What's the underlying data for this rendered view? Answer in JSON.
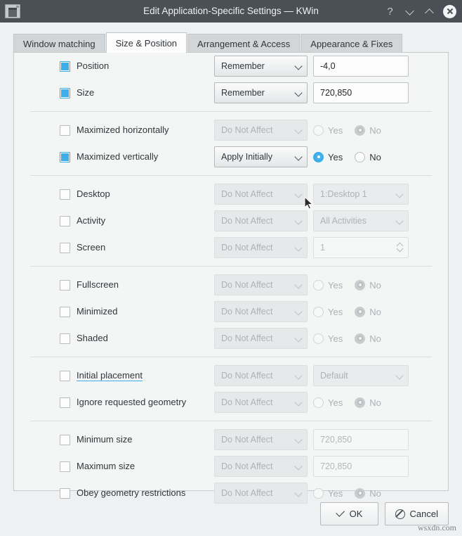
{
  "window": {
    "title": "Edit Application-Specific Settings — KWin",
    "icon": "window-settings-icon",
    "help_label": "?",
    "minimize_label": "minimize",
    "maximize_label": "maximize",
    "close_label": "close"
  },
  "colors": {
    "titlebar": "#4a5055",
    "accent": "#3daee9",
    "panel": "#f4f5f5",
    "text": "#31363b",
    "disabled_text": "#aeb2b6"
  },
  "tabs": [
    {
      "label": "Window matching",
      "active": false
    },
    {
      "label": "Size & Position",
      "active": true
    },
    {
      "label": "Arrangement & Access",
      "active": false
    },
    {
      "label": "Appearance & Fixes",
      "active": false
    }
  ],
  "options": {
    "do_not_affect": "Do Not Affect",
    "remember": "Remember",
    "apply_initially": "Apply Initially",
    "yes": "Yes",
    "no": "No"
  },
  "rows": [
    {
      "label": "Position",
      "checked": true,
      "policy": "Remember",
      "policy_enabled": true,
      "value_type": "text",
      "value": "-4,0"
    },
    {
      "label": "Size",
      "checked": true,
      "policy": "Remember",
      "policy_enabled": true,
      "value_type": "text",
      "value": "720,850"
    },
    {
      "label": "Maximized horizontally",
      "checked": false,
      "policy": "Do Not Affect",
      "policy_enabled": false,
      "value_type": "radio",
      "selected": "No",
      "value_enabled": false
    },
    {
      "label": "Maximized vertically",
      "checked": true,
      "policy": "Apply Initially",
      "policy_enabled": true,
      "value_type": "radio",
      "selected": "Yes",
      "value_enabled": true
    },
    {
      "label": "Desktop",
      "checked": false,
      "policy": "Do Not Affect",
      "policy_enabled": false,
      "value_type": "combo",
      "value": "1:Desktop 1",
      "value_enabled": false
    },
    {
      "label": "Activity",
      "checked": false,
      "policy": "Do Not Affect",
      "policy_enabled": false,
      "value_type": "combo",
      "value": "All Activities",
      "value_enabled": false
    },
    {
      "label": "Screen",
      "checked": false,
      "policy": "Do Not Affect",
      "policy_enabled": false,
      "value_type": "spin",
      "value": "1",
      "value_enabled": false
    },
    {
      "label": "Fullscreen",
      "checked": false,
      "policy": "Do Not Affect",
      "policy_enabled": false,
      "value_type": "radio",
      "selected": "No",
      "value_enabled": false
    },
    {
      "label": "Minimized",
      "checked": false,
      "policy": "Do Not Affect",
      "policy_enabled": false,
      "value_type": "radio",
      "selected": "No",
      "value_enabled": false
    },
    {
      "label": "Shaded",
      "checked": false,
      "policy": "Do Not Affect",
      "policy_enabled": false,
      "value_type": "radio",
      "selected": "No",
      "value_enabled": false
    },
    {
      "label": "Initial placement",
      "checked": false,
      "policy": "Do Not Affect",
      "policy_enabled": false,
      "value_type": "combo",
      "value": "Default",
      "value_enabled": false,
      "underlined": true
    },
    {
      "label": "Ignore requested geometry",
      "checked": false,
      "policy": "Do Not Affect",
      "policy_enabled": false,
      "value_type": "radio",
      "selected": "No",
      "value_enabled": false
    },
    {
      "label": "Minimum size",
      "checked": false,
      "policy": "Do Not Affect",
      "policy_enabled": false,
      "value_type": "text",
      "value": "720,850",
      "value_enabled": false
    },
    {
      "label": "Maximum size",
      "checked": false,
      "policy": "Do Not Affect",
      "policy_enabled": false,
      "value_type": "text",
      "value": "720,850",
      "value_enabled": false
    },
    {
      "label": "Obey geometry restrictions",
      "checked": false,
      "policy": "Do Not Affect",
      "policy_enabled": false,
      "value_type": "radio",
      "selected": "No",
      "value_enabled": false
    }
  ],
  "separators_after": [
    1,
    3,
    6,
    9,
    11
  ],
  "buttons": {
    "ok": "OK",
    "cancel": "Cancel"
  },
  "watermark": "wsxdn.com"
}
